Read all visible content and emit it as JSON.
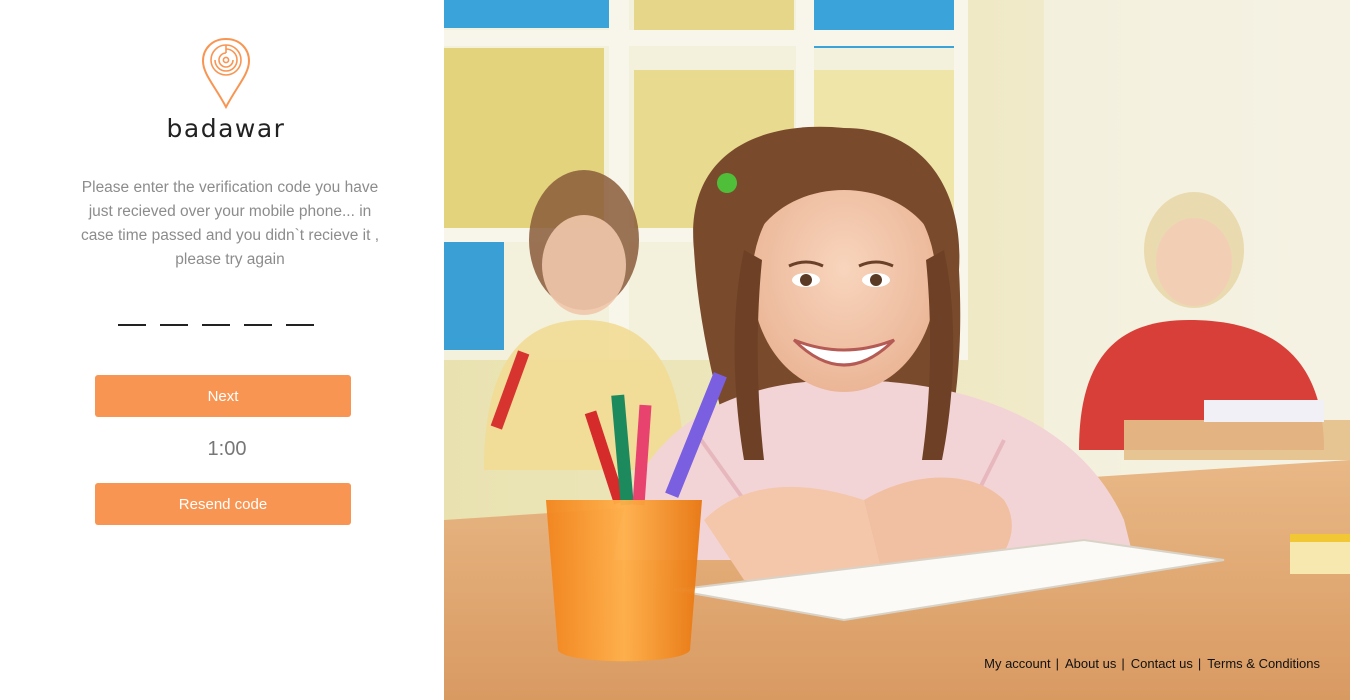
{
  "brand": {
    "name": "badawar",
    "accent_color": "#F99552",
    "logo_icon": "map-pin-logo-icon"
  },
  "verification": {
    "instructions": "Please enter the verification code you have just recieved over your mobile phone... in  case time passed and you didn`t recieve it , please try again",
    "code_digits": [
      "",
      "",
      "",
      "",
      ""
    ],
    "next_label": "Next",
    "timer": "1:00",
    "resend_label": "Resend code"
  },
  "hero_image": {
    "description_icon": "classroom-photo"
  },
  "footer": {
    "links": [
      {
        "label": "My account"
      },
      {
        "label": "About us"
      },
      {
        "label": "Contact us"
      },
      {
        "label": "Terms & Conditions"
      }
    ],
    "separator": "|"
  }
}
